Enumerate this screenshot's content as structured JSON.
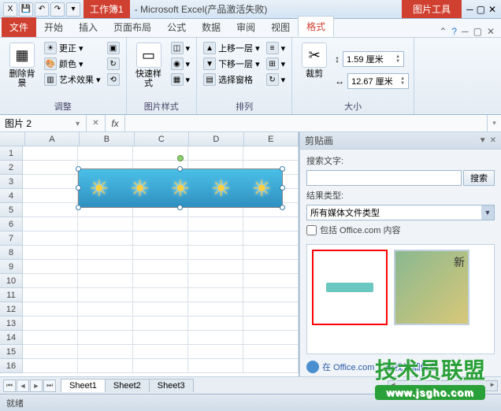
{
  "title": {
    "workbook": "工作簿1",
    "app": "Microsoft Excel(产品激活失败)",
    "context_tool": "图片工具"
  },
  "tabs": {
    "file": "文件",
    "home": "开始",
    "insert": "插入",
    "layout": "页面布局",
    "formulas": "公式",
    "data": "数据",
    "review": "审阅",
    "view": "视图",
    "format": "格式"
  },
  "ribbon": {
    "group1_label": "调整",
    "remove_bg": "删除背景",
    "correct": "更正",
    "color": "颜色",
    "artistic": "艺术效果",
    "group2_label": "图片样式",
    "quick_style": "快速样式",
    "group3_label": "排列",
    "bring_fwd": "上移一层",
    "send_back": "下移一层",
    "select_pane": "选择窗格",
    "group4_label": "大小",
    "crop": "裁剪",
    "height": "1.59 厘米",
    "width": "12.67 厘米"
  },
  "namebox": "图片 2",
  "columns": [
    "A",
    "B",
    "C",
    "D",
    "E"
  ],
  "rows": [
    "1",
    "2",
    "3",
    "4",
    "5",
    "6",
    "7",
    "8",
    "9",
    "10",
    "11",
    "12",
    "13",
    "14",
    "15",
    "16"
  ],
  "sheets": [
    "Sheet1",
    "Sheet2",
    "Sheet3"
  ],
  "clipart": {
    "title": "剪贴画",
    "search_label": "搜索文字:",
    "search_btn": "搜索",
    "type_label": "结果类型:",
    "type_value": "所有媒体文件类型",
    "include_office": "包括 Office.com 内容",
    "footer_link": "在 Office.com 上查找详细信息"
  },
  "status": "就绪",
  "watermark": {
    "text": "技术员联盟",
    "url": "www.jsgho.com"
  }
}
